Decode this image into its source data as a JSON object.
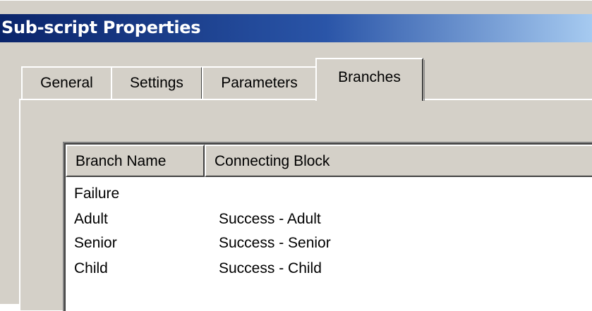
{
  "window": {
    "title": "Sub-script Properties"
  },
  "tabs": [
    {
      "label": "General"
    },
    {
      "label": "Settings"
    },
    {
      "label": "Parameters"
    },
    {
      "label": "Branches",
      "selected": true
    }
  ],
  "branches_list": {
    "columns": [
      "Branch Name",
      "Connecting Block"
    ],
    "rows": [
      {
        "branch_name": "Failure",
        "connecting_block": ""
      },
      {
        "branch_name": "Adult",
        "connecting_block": "Success - Adult"
      },
      {
        "branch_name": "Senior",
        "connecting_block": "Success - Senior"
      },
      {
        "branch_name": "Child",
        "connecting_block": "Success - Child"
      }
    ]
  },
  "colors": {
    "title_bar": "#0a246a",
    "dialog_face": "#d4d0c8",
    "list_background": "#ffffff"
  }
}
